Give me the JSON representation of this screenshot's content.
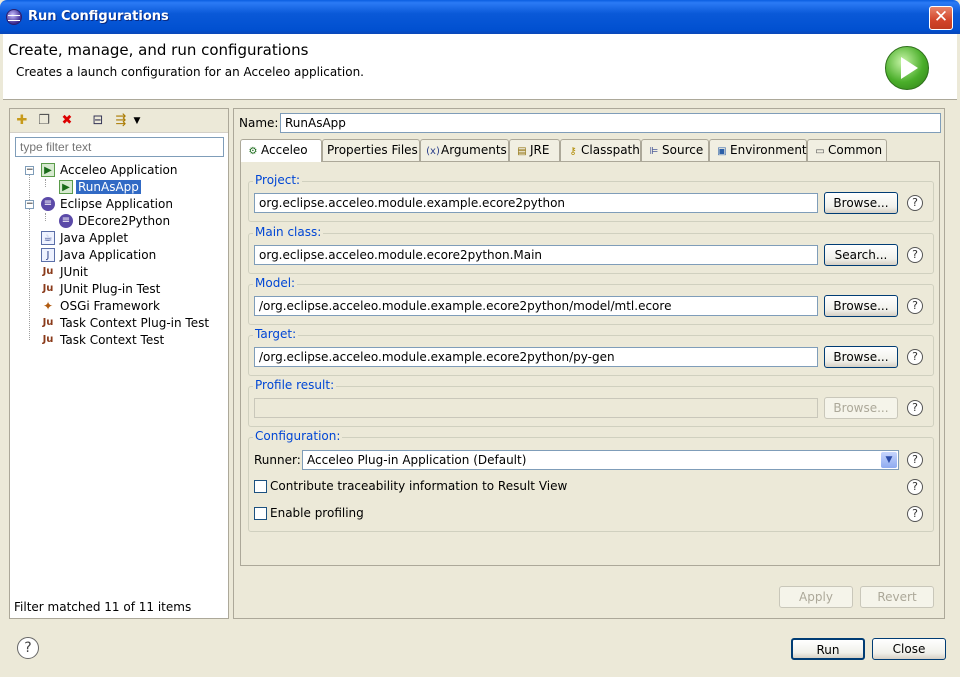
{
  "window": {
    "title": "Run Configurations",
    "close_label": "✕"
  },
  "banner": {
    "heading": "Create, manage, and run configurations",
    "description": "Creates a launch configuration for an Acceleo application."
  },
  "left": {
    "toolbar_icons": [
      "new-config-icon",
      "duplicate-icon",
      "delete-icon",
      "collapse-all-icon",
      "filter-icon",
      "dropdown-arrow-icon"
    ],
    "filter_placeholder": "type filter text",
    "tree": [
      {
        "label": "Acceleo Application",
        "icon": "acceleo-app-icon",
        "expanded": true
      },
      {
        "label": "RunAsApp",
        "icon": "acceleo-config-icon",
        "selected": true,
        "child": true
      },
      {
        "label": "Eclipse Application",
        "icon": "eclipse-app-icon",
        "expanded": true
      },
      {
        "label": "DEcore2Python",
        "icon": "eclipse-config-icon",
        "child": true
      },
      {
        "label": "Java Applet",
        "icon": "java-applet-icon"
      },
      {
        "label": "Java Application",
        "icon": "java-app-icon"
      },
      {
        "label": "JUnit",
        "icon": "junit-icon"
      },
      {
        "label": "JUnit Plug-in Test",
        "icon": "junit-plugin-icon"
      },
      {
        "label": "OSGi Framework",
        "icon": "osgi-icon"
      },
      {
        "label": "Task Context Plug-in Test",
        "icon": "task-context-plugin-icon"
      },
      {
        "label": "Task Context Test",
        "icon": "task-context-icon"
      }
    ],
    "status": "Filter matched 11 of 11 items"
  },
  "right": {
    "name_label": "Name:",
    "name_value": "RunAsApp",
    "tabs": [
      {
        "label": "Acceleo",
        "icon": "acceleo-tab-icon",
        "active": true
      },
      {
        "label": "Properties Files",
        "icon": ""
      },
      {
        "label": "Arguments",
        "icon": "arguments-icon"
      },
      {
        "label": "JRE",
        "icon": "jre-icon"
      },
      {
        "label": "Classpath",
        "icon": "classpath-icon"
      },
      {
        "label": "Source",
        "icon": "source-icon"
      },
      {
        "label": "Environment",
        "icon": "environment-icon"
      },
      {
        "label": "Common",
        "icon": "common-icon"
      }
    ],
    "project": {
      "label": "Project:",
      "value": "org.eclipse.acceleo.module.example.ecore2python",
      "button": "Browse..."
    },
    "main_class": {
      "label": "Main class:",
      "value": "org.eclipse.acceleo.module.ecore2python.Main",
      "button": "Search..."
    },
    "model": {
      "label": "Model:",
      "value": "/org.eclipse.acceleo.module.example.ecore2python/model/mtl.ecore",
      "button": "Browse..."
    },
    "target": {
      "label": "Target:",
      "value": "/org.eclipse.acceleo.module.example.ecore2python/py-gen",
      "button": "Browse..."
    },
    "profile": {
      "label": "Profile result:",
      "value": "",
      "button": "Browse..."
    },
    "configuration": {
      "label": "Configuration:",
      "runner_label": "Runner:",
      "runner_value": "Acceleo Plug-in Application (Default)",
      "traceability_label": "Contribute traceability information to Result View",
      "traceability_checked": false,
      "profiling_label": "Enable profiling",
      "profiling_checked": false
    },
    "help_glyph": "?",
    "apply_label": "Apply",
    "revert_label": "Revert"
  },
  "footer": {
    "help_glyph": "?",
    "run_label": "Run",
    "close_label": "Close"
  }
}
